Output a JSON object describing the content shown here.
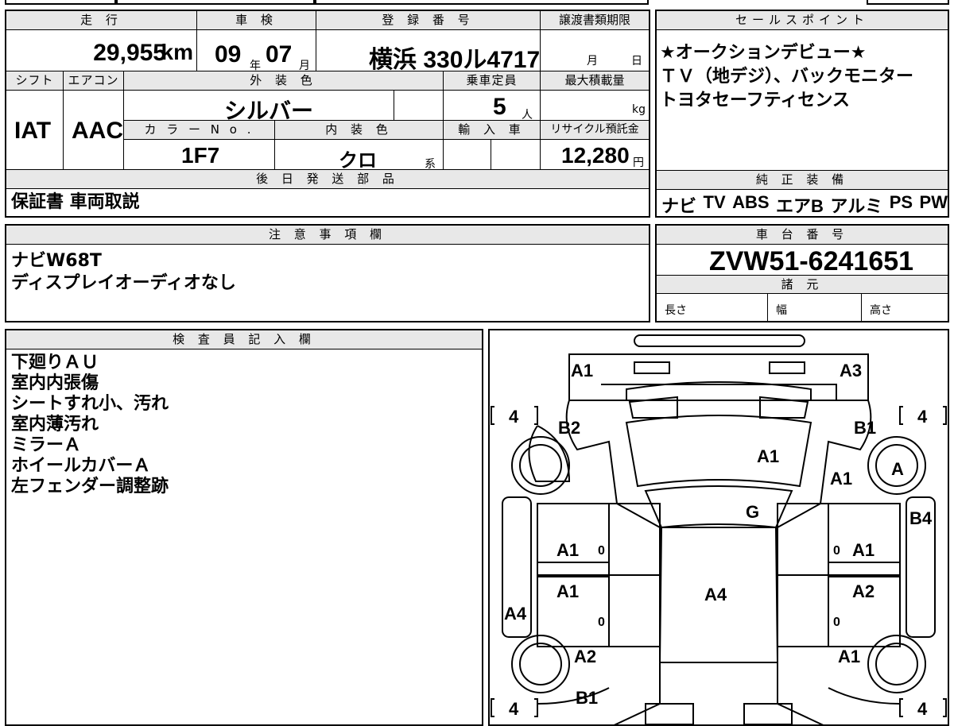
{
  "sheet": {
    "mileage": {
      "label": "走 行",
      "value": "29,955",
      "unit": "km"
    },
    "shaken": {
      "label": "車 検",
      "year": "09",
      "year_unit": "年",
      "month": "07",
      "month_unit": "月"
    },
    "registration": {
      "label": "登 録 番 号",
      "value": "横浜 330ル4717"
    },
    "transfer_deadline": {
      "label": "譲渡書類期限",
      "month_unit": "月",
      "day_unit": "日"
    },
    "shift": {
      "label": "シフト",
      "value": "IAT"
    },
    "aircon": {
      "label": "エアコン",
      "value": "AAC"
    },
    "exterior_color": {
      "label": "外 装 色",
      "value": "シルバー"
    },
    "capacity": {
      "label": "乗車定員",
      "value": "5",
      "unit": "人"
    },
    "max_load": {
      "label": "最大積載量",
      "unit": "kg"
    },
    "color_no": {
      "label": "カ ラ ー N o .",
      "value": "1F7"
    },
    "interior_color": {
      "label": "内 装 色",
      "value": "クロ",
      "suffix": "系"
    },
    "import": {
      "label": "輸 入 車"
    },
    "recycle_fee": {
      "label": "リサイクル預託金",
      "value": "12,280",
      "unit": "円"
    },
    "later_parts": {
      "label": "後 日 発 送 部 品",
      "value": "保証書 車両取説"
    },
    "sales_points": {
      "label": "セールスポイント",
      "lines": [
        "★オークションデビュー★",
        "ＴＶ（地デジ）、バックモニター",
        "トヨタセーフティセンス"
      ]
    },
    "genuine_equipment": {
      "label": "純 正 装 備",
      "items": [
        "ナビ",
        "TV",
        "ABS",
        "エアB",
        "アルミ",
        "PS",
        "PW"
      ]
    },
    "notes": {
      "label": "注 意 事 項 欄",
      "lines": [
        "ナビW68T",
        "ディスプレイオーディオなし"
      ]
    },
    "chassis": {
      "label": "車 台 番 号",
      "value": "ZVW51-6241651"
    },
    "specs": {
      "label": "諸 元",
      "length": "長さ",
      "width": "幅",
      "height": "高さ"
    },
    "inspector": {
      "label": "検 査 員 記 入 欄",
      "lines": [
        "下廻りＡＵ",
        "室内内張傷",
        "シートすれ小、汚れ",
        "室内薄汚れ",
        "ミラーＡ",
        "ホイールカバーＡ",
        "左フェンダー調整跡"
      ]
    },
    "diagram": {
      "marks": {
        "front_left": "A1",
        "front_right": "A3",
        "left_front_fender": "B2",
        "right_front_fender": "B1",
        "hood": "A1",
        "right_fender_lower": "A1",
        "right_front_wheel": "A",
        "windshield": "G",
        "right_rocker": "B4",
        "left_front_door": "A1",
        "right_front_door": "A1",
        "left_rear_door": "A1",
        "right_rear_door": "A2",
        "roof": "A4",
        "left_rocker": "A4",
        "left_rear_fender": "A2",
        "right_rear_fender": "A1",
        "rear_left": "B1"
      },
      "tread": {
        "fl": "4",
        "fr": "4",
        "rl": "4",
        "rr": "4"
      },
      "door_zero": "0"
    }
  }
}
